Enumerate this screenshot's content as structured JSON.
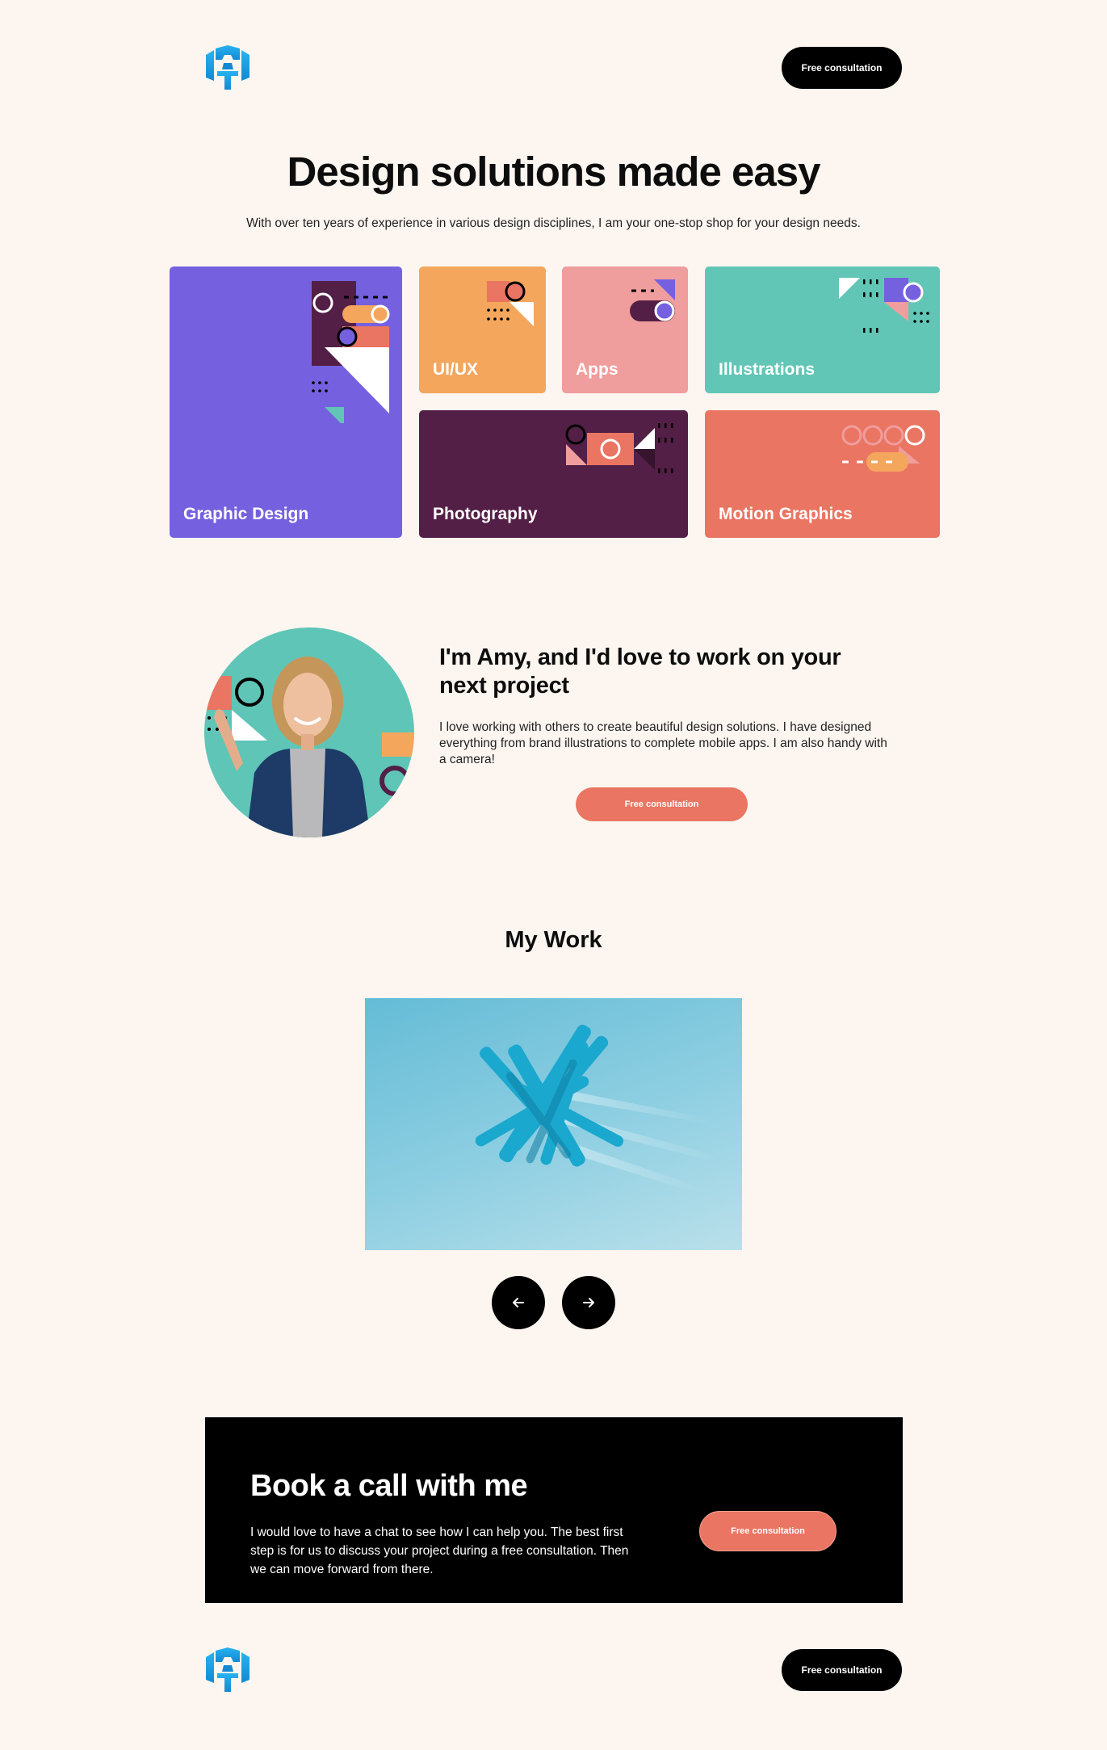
{
  "header": {
    "cta_label": "Free consultation",
    "logo_icon": "a-t-monogram-logo"
  },
  "hero": {
    "title": "Design solutions made easy",
    "subtitle": "With over ten years of experience in various design disciplines, I am your one-stop shop for your design needs."
  },
  "services": [
    {
      "label": "Graphic Design",
      "color": "#7561df"
    },
    {
      "label": "UI/UX",
      "color": "#f4a65d"
    },
    {
      "label": "Apps",
      "color": "#f09d9d"
    },
    {
      "label": "Illustrations",
      "color": "#62c6b6"
    },
    {
      "label": "Photography",
      "color": "#531f46"
    },
    {
      "label": "Motion Graphics",
      "color": "#ea7562"
    }
  ],
  "about": {
    "title": "I'm Amy, and I'd love to work on your next project",
    "body": "I love working with others to create beautiful design solutions. I have designed everything from brand illustrations to complete mobile apps. I am also handy with a camera!",
    "cta_label": "Free consultation"
  },
  "work": {
    "title": "My Work",
    "prev_icon": "arrow-left-icon",
    "next_icon": "arrow-right-icon"
  },
  "booking": {
    "title": "Book a call with me",
    "body": "I would love to have a chat to see how I can help you. The best first step is for us to discuss your project during a free consultation. Then we can move forward from there.",
    "cta_label": "Free consultation"
  },
  "footer": {
    "cta_label": "Free consultation"
  },
  "colors": {
    "background": "#fdf6f0",
    "accent": "#ea7562",
    "dark": "#000000",
    "logo_blue": "#1ea7e8"
  }
}
